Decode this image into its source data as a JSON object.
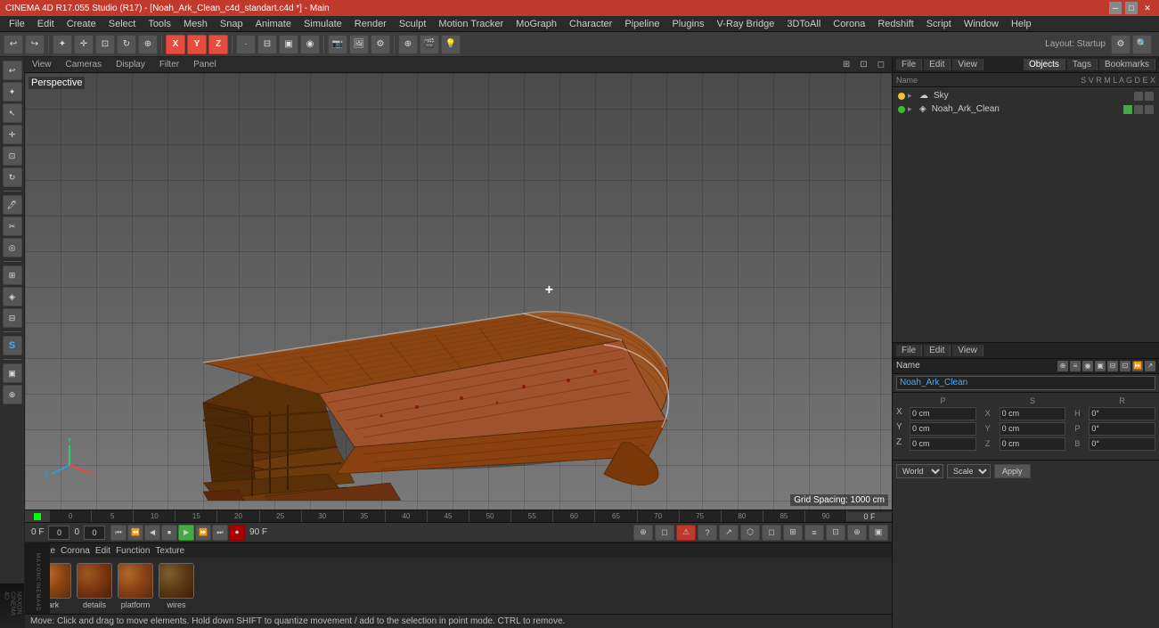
{
  "titlebar": {
    "title": "CINEMA 4D R17.055 Studio (R17) - [Noah_Ark_Clean_c4d_standart.c4d *] - Main",
    "controls": [
      "minimize",
      "maximize",
      "close"
    ]
  },
  "menubar": {
    "items": [
      "File",
      "Edit",
      "Create",
      "Select",
      "Tools",
      "Mesh",
      "Snap",
      "Animate",
      "Simulate",
      "Render",
      "Sculpt",
      "Motion Tracker",
      "MoGraph",
      "Character",
      "Pipeline",
      "Plugins",
      "V-Ray Bridge",
      "3DToAll",
      "Corona",
      "Redshift",
      "Script",
      "Window",
      "Help"
    ]
  },
  "toolbar": {
    "layout_label": "Layout: Startup",
    "undo_label": "↩",
    "tools": [
      "↩",
      "↪",
      "✦",
      "⊕",
      "⊗",
      "◯",
      "■",
      "✱",
      "X",
      "Y",
      "Z",
      "—",
      "⊞",
      "▷",
      "⊡",
      "⬡",
      "◈",
      "⊕",
      "≡",
      "◉",
      "⊙",
      "▣",
      "⊕"
    ]
  },
  "viewport": {
    "label": "Perspective",
    "topbar_items": [
      "View",
      "Cameras",
      "Display",
      "Filter",
      "Panel"
    ],
    "crosshair": "+",
    "grid_spacing": "Grid Spacing: 1000 cm"
  },
  "timeline": {
    "markers": [
      "0",
      "5",
      "10",
      "15",
      "20",
      "25",
      "30",
      "35",
      "40",
      "45",
      "50",
      "55",
      "60",
      "65",
      "70",
      "75",
      "80",
      "85",
      "90"
    ],
    "start_frame": "0 F",
    "end_frame": "90 F",
    "current_frame": "0 F",
    "fps_label": "0 F"
  },
  "playback": {
    "frame_start": "0 F",
    "fps": "0",
    "buttons": [
      "⏮",
      "⏭",
      "◀",
      "⏸",
      "▶",
      "⏩",
      "⏭",
      "⏺"
    ],
    "render_buttons": [
      "🎬",
      "🖼",
      "⚙",
      "⚠",
      "?",
      "↗",
      "⬡",
      "◻",
      "⊞",
      "≡",
      "⊡",
      "⊕",
      "▣"
    ]
  },
  "materials": {
    "menu": [
      "Create",
      "Corona",
      "Edit",
      "Function",
      "Texture"
    ],
    "items": [
      {
        "name": "ark",
        "color": "#8B4513"
      },
      {
        "name": "details",
        "color": "#6B3410"
      },
      {
        "name": "platform",
        "color": "#7B3E0D"
      },
      {
        "name": "wires",
        "color": "#5a3010"
      }
    ]
  },
  "status_bar": {
    "message": "Move: Click and drag to move elements. Hold down SHIFT to quantize movement / add to the selection in point mode. CTRL to remove."
  },
  "scene_objects": {
    "panel_tabs": [
      "File",
      "Edit",
      "View"
    ],
    "sub_tabs": [
      "Objects",
      "Tags",
      "Bookmarks"
    ],
    "items": [
      {
        "name": "Sky",
        "type": "sky",
        "level": 0,
        "dot_color": "yellow",
        "selected": false
      },
      {
        "name": "Noah_Ark_Clean",
        "type": "mesh",
        "level": 0,
        "dot_color": "green",
        "selected": false
      }
    ]
  },
  "properties_panel": {
    "panel_tabs": [
      "File",
      "Edit",
      "View"
    ],
    "name": "Noah_Ark_Clean",
    "header": "Name",
    "coords": {
      "x": {
        "pos": "0 cm",
        "size": "0 cm",
        "rot": "0°"
      },
      "y": {
        "pos": "0 cm",
        "size": "0 cm",
        "rot": "0°"
      },
      "z": {
        "pos": "0 cm",
        "size": "0 cm",
        "rot": "0°"
      }
    },
    "world_label": "World",
    "scale_label": "Scale",
    "apply_label": "Apply"
  },
  "axes": {
    "x_color": "#e74c3c",
    "y_color": "#2ecc71",
    "z_color": "#3498db"
  }
}
